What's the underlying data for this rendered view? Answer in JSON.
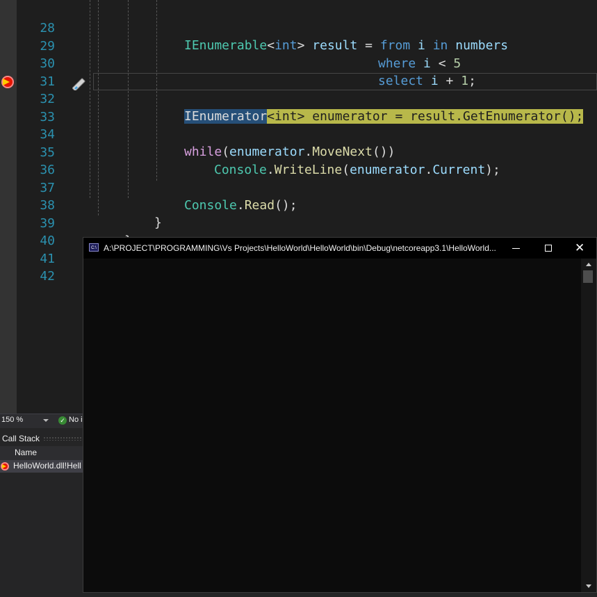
{
  "editor": {
    "line_numbers": [
      "28",
      "29",
      "30",
      "31",
      "32",
      "33",
      "34",
      "35",
      "36",
      "37",
      "38",
      "39",
      "40",
      "41",
      "42"
    ],
    "lines": {
      "l28": [
        "IEnumerable",
        "<",
        "int",
        "> ",
        "result",
        " = ",
        "from",
        " ",
        "i",
        " ",
        "in",
        " ",
        "numbers"
      ],
      "l29": [
        "where",
        " ",
        "i",
        " < ",
        "5"
      ],
      "l30": [
        "select",
        " ",
        "i",
        " + ",
        "1",
        ";"
      ],
      "l32": [
        "IEnumerator",
        "<int> enumerator = result.GetEnumerator();"
      ],
      "l34": [
        "while",
        "(",
        "enumerator",
        ".",
        "MoveNext",
        "())"
      ],
      "l35": [
        "Console",
        ".",
        "WriteLine",
        "(",
        "enumerator",
        ".",
        "Current",
        ");"
      ],
      "l37": [
        "Console",
        ".",
        "Read",
        "();"
      ],
      "l38": [
        "}"
      ],
      "l39": [
        "}"
      ],
      "l40": [
        "}"
      ]
    },
    "breakpoint_icon": "breakpoint-current-statement-icon",
    "quick_action_icon": "edit-and-continue-pencil-icon"
  },
  "status_bar": {
    "zoom": "150 %",
    "issues_text": "No i"
  },
  "call_stack": {
    "title": "Call Stack",
    "column_name": "Name",
    "row_text": "HelloWorld.dll!Hell"
  },
  "console_window": {
    "icon_text": "C:\\",
    "title": "A:\\PROJECT\\PROGRAMMING\\Vs Projects\\HelloWorld\\HelloWorld\\bin\\Debug\\netcoreapp3.1\\HelloWorld...",
    "close_glyph": "✕"
  },
  "colors": {
    "type": "#4ec9b0",
    "keyword": "#569cd6",
    "control": "#d8a0df",
    "variable": "#9cdcfe",
    "method": "#dcdcaa",
    "number": "#b5cea8",
    "line_number": "#2b91af",
    "highlight_yellow": "#b8b84a",
    "highlight_blue": "#264f78"
  }
}
